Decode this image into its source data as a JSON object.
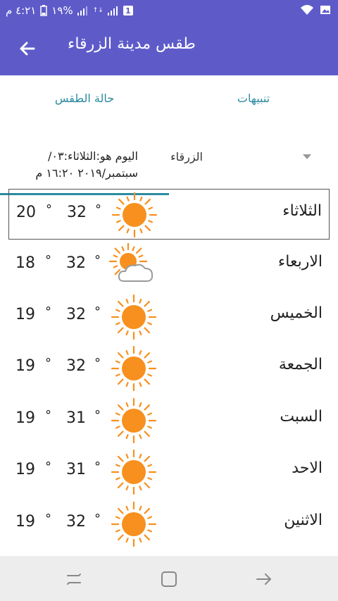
{
  "status_bar": {
    "time": "٤:٢١ م",
    "battery": "١٩%",
    "notification_badge": "1"
  },
  "app_bar": {
    "title": "طقس مدينة الزرقاء"
  },
  "tabs": [
    {
      "label": "تنبيهات",
      "active": false
    },
    {
      "label": "حالة الطقس",
      "active": true
    }
  ],
  "city_select": {
    "value": "الزرقاء"
  },
  "date_info": "اليوم هو:الثلاثاء:٠٣/سبتمبر/٢٠١٩ ١٦:٢٠ م",
  "forecast": [
    {
      "day": "الثلاثاء",
      "max": "32",
      "min": "20",
      "icon": "sun-icon",
      "selected": true
    },
    {
      "day": "الاربعاء",
      "max": "32",
      "min": "18",
      "icon": "partly-cloudy-icon",
      "selected": false
    },
    {
      "day": "الخميس",
      "max": "32",
      "min": "19",
      "icon": "sun-icon",
      "selected": false
    },
    {
      "day": "الجمعة",
      "max": "32",
      "min": "19",
      "icon": "sun-icon",
      "selected": false
    },
    {
      "day": "السبت",
      "max": "31",
      "min": "19",
      "icon": "sun-icon",
      "selected": false
    },
    {
      "day": "الاحد",
      "max": "31",
      "min": "19",
      "icon": "sun-icon",
      "selected": false
    },
    {
      "day": "الاثنين",
      "max": "32",
      "min": "19",
      "icon": "sun-icon",
      "selected": false
    }
  ],
  "degree_symbol": "°",
  "colors": {
    "primary": "#5e5bc9",
    "accent": "#2a8aa0",
    "sun": "#f7901e"
  }
}
